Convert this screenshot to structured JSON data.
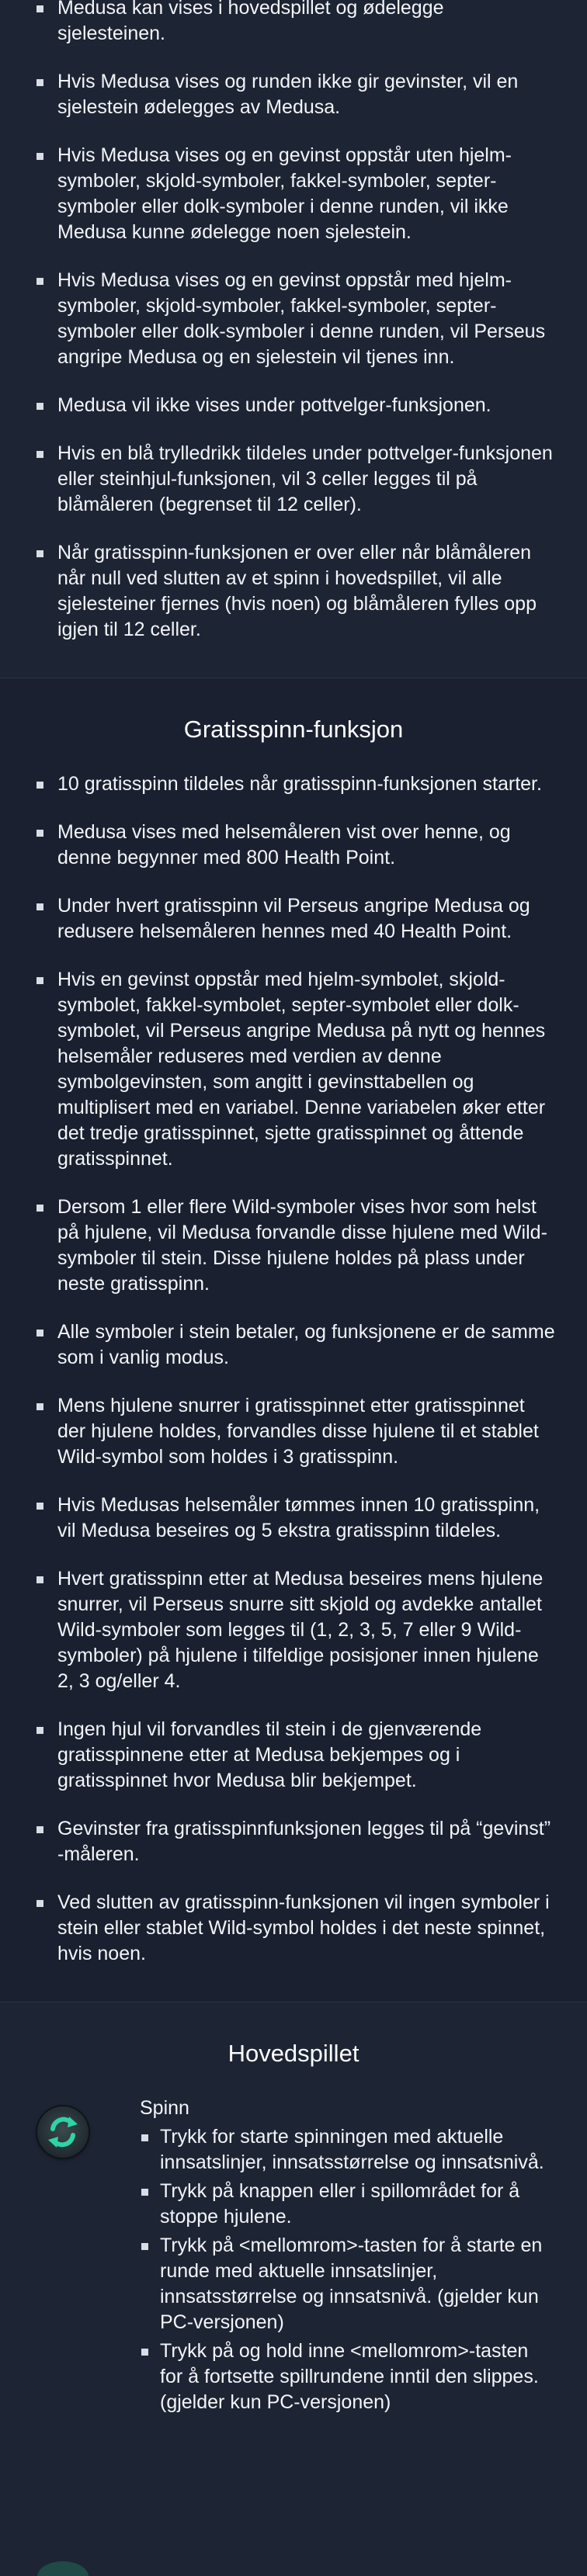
{
  "medusa_section": {
    "items": [
      "Medusa kan vises i hovedspillet og ødelegge sjelesteinen.",
      "Hvis Medusa vises og runden ikke gir gevinster, vil en sjelestein ødelegges av Medusa.",
      "Hvis Medusa vises og en gevinst oppstår uten hjelm-symboler, skjold-symboler, fakkel-symboler, septer-symboler eller dolk-symboler i denne runden, vil ikke Medusa kunne ødelegge noen sjelestein.",
      "Hvis Medusa vises og en gevinst oppstår med hjelm-symboler, skjold-symboler, fakkel-symboler, septer-symboler eller dolk-symboler i denne runden, vil Perseus angripe Medusa og en sjelestein vil tjenes inn.",
      "Medusa vil ikke vises under pottvelger-funksjonen.",
      "Hvis en blå trylledrikk tildeles under pottvelger-funksjonen eller steinhjul-funksjonen, vil 3 celler legges til på blåmåleren (begrenset til 12 celler).",
      "Når gratisspinn-funksjonen er over eller når blåmåleren når null ved slutten av et spinn i hovedspillet, vil alle sjelesteiner fjernes (hvis noen) og blåmåleren fylles opp igjen til 12 celler."
    ]
  },
  "free_spins_section": {
    "title": "Gratisspinn-funksjon",
    "items": [
      "10 gratisspinn tildeles når gratisspinn-funksjonen starter.",
      "Medusa vises med helsemåleren vist over henne, og denne begynner med 800 Health Point.",
      "Under hvert gratisspinn vil Perseus angripe Medusa og redusere helsemåleren hennes med 40 Health Point.",
      "Hvis en gevinst oppstår med hjelm-symbolet, skjold-symbolet, fakkel-symbolet, septer-symbolet eller dolk-symbolet, vil Perseus angripe Medusa på nytt og hennes helsemåler reduseres med verdien av denne symbolgevinsten, som angitt i gevinsttabellen og multiplisert med en variabel. Denne variabelen øker etter det tredje gratisspinnet, sjette gratisspinnet og åttende gratisspinnet.",
      "Dersom 1 eller flere Wild-symboler vises hvor som helst på hjulene, vil Medusa forvandle disse hjulene med Wild-symboler til stein. Disse hjulene holdes på plass under neste gratisspinn.",
      "Alle symboler i stein betaler, og funksjonene er de samme som i vanlig modus.",
      "Mens hjulene snurrer i gratisspinnet etter gratisspinnet der hjulene holdes, forvandles disse hjulene til et stablet Wild-symbol som holdes i 3 gratisspinn.",
      "Hvis Medusas helsemåler tømmes innen 10 gratisspinn, vil Medusa beseires og 5 ekstra gratisspinn tildeles.",
      "Hvert gratisspinn etter at Medusa beseires mens hjulene snurrer, vil Perseus snurre sitt skjold og avdekke antallet Wild-symboler som legges til (1, 2, 3, 5, 7 eller 9 Wild-symboler) på hjulene i tilfeldige posisjoner innen hjulene 2, 3 og/eller 4.",
      "Ingen hjul vil forvandles til stein i de gjenværende gratisspinnene etter at Medusa bekjempes og i gratisspinnet hvor Medusa blir bekjempet.",
      "Gevinster fra gratisspinnfunksjonen legges til på “gevinst” -måleren.",
      "Ved slutten av gratisspinn-funksjonen vil ingen symboler i stein eller stablet Wild-symbol holdes i det neste spinnet, hvis noen."
    ]
  },
  "main_game_section": {
    "title": "Hovedspillet",
    "controls": [
      {
        "icon": "spin-icon",
        "name": "Spinn",
        "items": [
          "Trykk for starte spinningen med aktuelle innsatslinjer, innsatsstørrelse og innsatsnivå.",
          "Trykk på knappen eller i spillområdet for å stoppe hjulene.",
          "Trykk på <mellomrom>-tasten for å starte en runde med aktuelle innsatslinjer, innsatsstørrelse og innsatsnivå. (gjelder kun PC-versjonen)",
          "Trykk på og hold inne <mellomrom>-tasten for å fortsette spillrundene inntil den slippes. (gjelder kun PC-versjonen)"
        ]
      }
    ]
  },
  "colors": {
    "background": "#1d2434",
    "text": "#ffffff",
    "icon_arrow": "#2fd3a6"
  }
}
